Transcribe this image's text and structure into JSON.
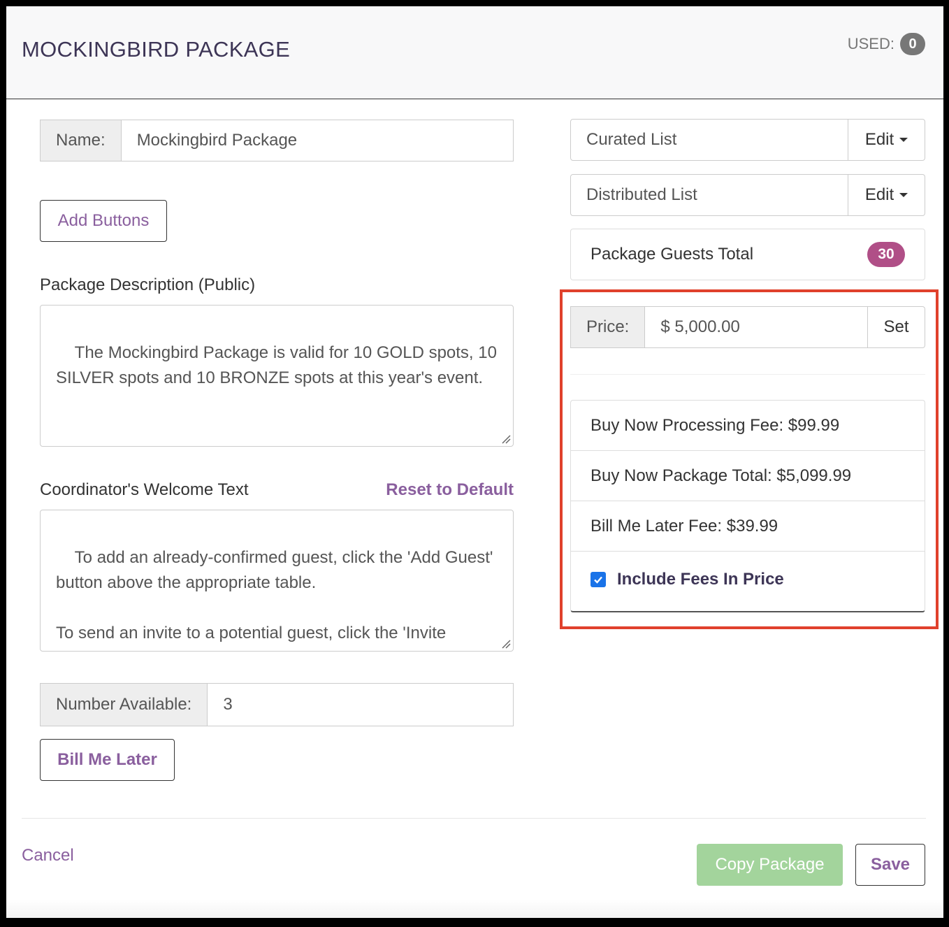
{
  "header": {
    "title": "MOCKINGBIRD PACKAGE",
    "used_label": "USED:",
    "used_count": "0"
  },
  "form": {
    "name_label": "Name:",
    "name_value": "Mockingbird Package",
    "add_buttons_label": "Add Buttons",
    "description_label": "Package Description (Public)",
    "description_value": "The Mockingbird Package is valid for 10 GOLD spots, 10 SILVER spots and 10 BRONZE spots at this year's event.",
    "welcome_label": "Coordinator's Welcome Text",
    "reset_label": "Reset to Default",
    "welcome_value": "To add an already-confirmed guest, click the 'Add Guest' button above the appropriate table.\n\nTo send an invite to a potential guest, click the 'Invite Guest' button above the appropriate table. The guest will receive an invite email for you to confirm their spot in",
    "number_label": "Number Available:",
    "number_value": "3",
    "bill_later_label": "Bill Me Later"
  },
  "lists": {
    "curated_label": "Curated List",
    "distributed_label": "Distributed List",
    "edit_label": "Edit",
    "guests_total_label": "Package Guests Total",
    "guests_total_value": "30"
  },
  "pricing": {
    "price_label": "Price:",
    "price_value": "$ 5,000.00",
    "set_label": "Set",
    "processing_fee": "Buy Now Processing Fee: $99.99",
    "package_total": "Buy Now Package Total: $5,099.99",
    "bill_later_fee": "Bill Me Later Fee: $39.99",
    "include_fees_label": "Include Fees In Price",
    "include_fees_checked": true
  },
  "footer": {
    "cancel_label": "Cancel",
    "copy_label": "Copy Package",
    "save_label": "Save"
  },
  "colors": {
    "accent": "#8a5f9e",
    "badge_pink": "#b04f87",
    "copy_green": "#a3d49c",
    "highlight_red": "#e0412c"
  }
}
